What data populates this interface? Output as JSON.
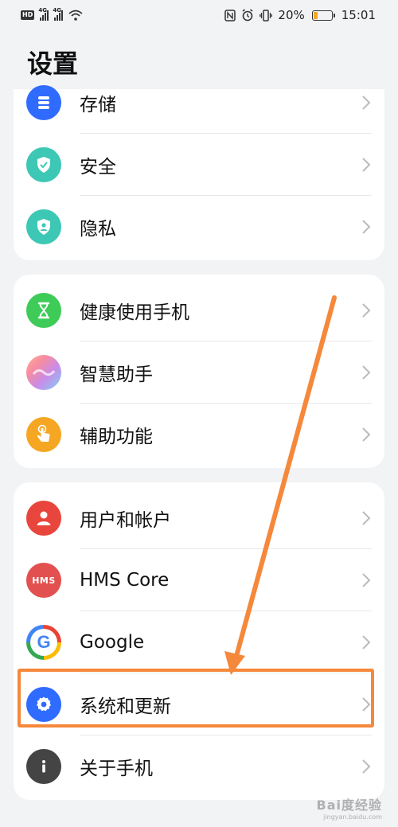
{
  "status_bar": {
    "hd": "HD",
    "sim1": "4G",
    "sim2": "4G",
    "battery_pct": "20%",
    "time": "15:01",
    "battery_level": 0.2
  },
  "page": {
    "title": "设置"
  },
  "groups": [
    {
      "items": [
        {
          "label": "存储",
          "icon": "storage-icon",
          "color": "#2f6bff"
        },
        {
          "label": "安全",
          "icon": "shield-icon",
          "color": "#3dc7b5"
        },
        {
          "label": "隐私",
          "icon": "privacy-shield-icon",
          "color": "#3dc7b5"
        }
      ]
    },
    {
      "items": [
        {
          "label": "健康使用手机",
          "icon": "hourglass-icon",
          "color": "#3ecb58"
        },
        {
          "label": "智慧助手",
          "icon": "smart-assistant-icon",
          "color": "#c98be8"
        },
        {
          "label": "辅助功能",
          "icon": "hand-pointer-icon",
          "color": "#f5a623"
        }
      ]
    },
    {
      "items": [
        {
          "label": "用户和帐户",
          "icon": "user-icon",
          "color": "#e8453c"
        },
        {
          "label": "HMS Core",
          "icon": "hms-core-icon",
          "icon_text": "HMS",
          "color": "#e25050"
        },
        {
          "label": "Google",
          "icon": "google-icon",
          "icon_text": "G",
          "color": "#ffffff"
        },
        {
          "label": "系统和更新",
          "icon": "gear-icon",
          "color": "#2f6bff"
        },
        {
          "label": "关于手机",
          "icon": "info-icon",
          "color": "#444444"
        }
      ]
    }
  ],
  "annotation": {
    "highlight_color": "#f5883b"
  },
  "watermark": {
    "brand": "Bai度经验",
    "url": "jingyan.baidu.com"
  }
}
